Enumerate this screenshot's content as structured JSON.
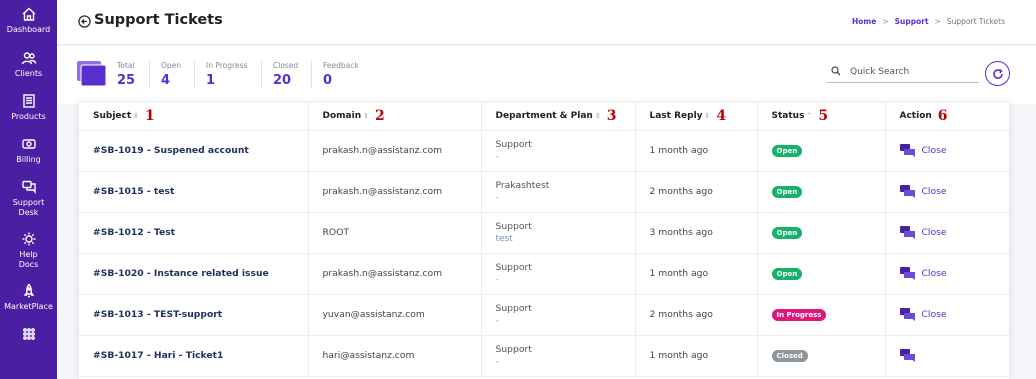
{
  "sidebar": {
    "items": [
      {
        "label": "Dashboard",
        "icon": "home-icon"
      },
      {
        "label": "Clients",
        "icon": "users-icon"
      },
      {
        "label": "Products",
        "icon": "box-icon"
      },
      {
        "label": "Billing",
        "icon": "money-icon"
      },
      {
        "label": "Support Desk",
        "icon": "chat-icon"
      },
      {
        "label": "Help Docs",
        "icon": "gear-icon"
      },
      {
        "label": "MarketPlace",
        "icon": "rocket-icon"
      },
      {
        "label": "",
        "icon": "apps-grid-icon"
      }
    ]
  },
  "header": {
    "title": "Support Tickets",
    "breadcrumb": {
      "home": "Home",
      "support": "Support",
      "current": "Support Tickets",
      "sep": ">"
    }
  },
  "stats": [
    {
      "label": "Total",
      "value": "25"
    },
    {
      "label": "Open",
      "value": "4"
    },
    {
      "label": "In Progress",
      "value": "1"
    },
    {
      "label": "Closed",
      "value": "20"
    },
    {
      "label": "Feedback",
      "value": "0"
    }
  ],
  "search": {
    "placeholder": "Quick Search"
  },
  "table": {
    "headers": [
      {
        "label": "Subject",
        "num": "1"
      },
      {
        "label": "Domain",
        "num": "2"
      },
      {
        "label": "Department & Plan",
        "num": "3"
      },
      {
        "label": "Last Reply",
        "num": "4"
      },
      {
        "label": "Status",
        "num": "5"
      },
      {
        "label": "Action",
        "num": "6"
      }
    ],
    "rows": [
      {
        "subject": "#SB-1019 - Suspened account",
        "domain": "prakash.n@assistanz.com",
        "dept": "Support",
        "plan": "-",
        "last_reply": "1 month ago",
        "status": "Open",
        "action": "Close"
      },
      {
        "subject": "#SB-1015 - test",
        "domain": "prakash.n@assistanz.com",
        "dept": "Prakashtest",
        "plan": "-",
        "last_reply": "2 months ago",
        "status": "Open",
        "action": "Close"
      },
      {
        "subject": "#SB-1012 - Test",
        "domain": "ROOT",
        "dept": "Support",
        "plan": "test",
        "last_reply": "3 months ago",
        "status": "Open",
        "action": "Close"
      },
      {
        "subject": "#SB-1020 - Instance related issue",
        "domain": "prakash.n@assistanz.com",
        "dept": "Support",
        "plan": "-",
        "last_reply": "1 month ago",
        "status": "Open",
        "action": "Close"
      },
      {
        "subject": "#SB-1013 - TEST-support",
        "domain": "yuvan@assistanz.com",
        "dept": "Support",
        "plan": "-",
        "last_reply": "2 months ago",
        "status": "In Progress",
        "action": "Close"
      },
      {
        "subject": "#SB-1017 - Hari - Ticket1",
        "domain": "hari@assistanz.com",
        "dept": "Support",
        "plan": "-",
        "last_reply": "1 month ago",
        "status": "Closed",
        "action": ""
      }
    ]
  },
  "colors": {
    "sidebar": "#4b1fa3",
    "accent": "#5a2ecf",
    "open": "#17b26a",
    "in_progress": "#e0157b",
    "closed": "#8e949c"
  }
}
